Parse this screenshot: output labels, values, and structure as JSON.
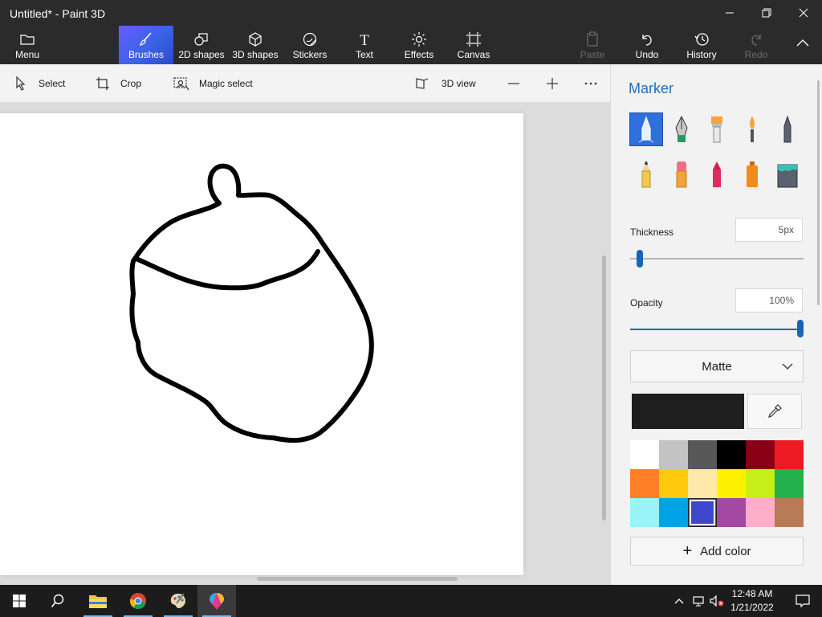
{
  "window": {
    "title": "Untitled* - Paint 3D"
  },
  "ribbon": {
    "menu_label": "Menu",
    "tabs": [
      {
        "label": "Brushes",
        "icon": "brush-icon",
        "active": true
      },
      {
        "label": "2D shapes",
        "icon": "2d-shapes-icon"
      },
      {
        "label": "3D shapes",
        "icon": "3d-shapes-icon"
      },
      {
        "label": "Stickers",
        "icon": "stickers-icon"
      },
      {
        "label": "Text",
        "icon": "text-icon"
      },
      {
        "label": "Effects",
        "icon": "effects-icon"
      },
      {
        "label": "Canvas",
        "icon": "canvas-icon"
      }
    ],
    "paste_label": "Paste",
    "undo_label": "Undo",
    "history_label": "History",
    "redo_label": "Redo"
  },
  "toolbar": {
    "select_label": "Select",
    "crop_label": "Crop",
    "magic_select_label": "Magic select",
    "view_3d_label": "3D view"
  },
  "panel": {
    "title": "Marker",
    "brushes": [
      {
        "name": "marker",
        "selected": true
      },
      {
        "name": "calligraphy-pen"
      },
      {
        "name": "oil-brush"
      },
      {
        "name": "watercolor"
      },
      {
        "name": "pixel-pen"
      },
      {
        "name": "pencil"
      },
      {
        "name": "eraser"
      },
      {
        "name": "crayon"
      },
      {
        "name": "spray-can"
      },
      {
        "name": "fill"
      }
    ],
    "thickness_label": "Thickness",
    "thickness_value": "5px",
    "thickness_fraction": 0.05,
    "opacity_label": "Opacity",
    "opacity_value": "100%",
    "opacity_fraction": 1.0,
    "finish_value": "Matte",
    "current_color": "#1e1e1e",
    "palette": [
      "#ffffff",
      "#c3c3c3",
      "#585858",
      "#000000",
      "#880015",
      "#ed1c24",
      "#ff7f27",
      "#ffc90e",
      "#fde9a8",
      "#fff200",
      "#c4ef19",
      "#22b14c",
      "#99f4fa",
      "#00a2e8",
      "#3f48cc",
      "#a349a4",
      "#ffaec9",
      "#b97a57"
    ],
    "selected_palette_index": 14,
    "add_color_label": "Add color"
  },
  "taskbar": {
    "time": "12:48 AM",
    "date": "1/21/2022"
  },
  "colors": {
    "accent": "#1f6fbf",
    "ribbon_bg": "#2b2b2b",
    "selected_brush": "#2f6fe0"
  }
}
